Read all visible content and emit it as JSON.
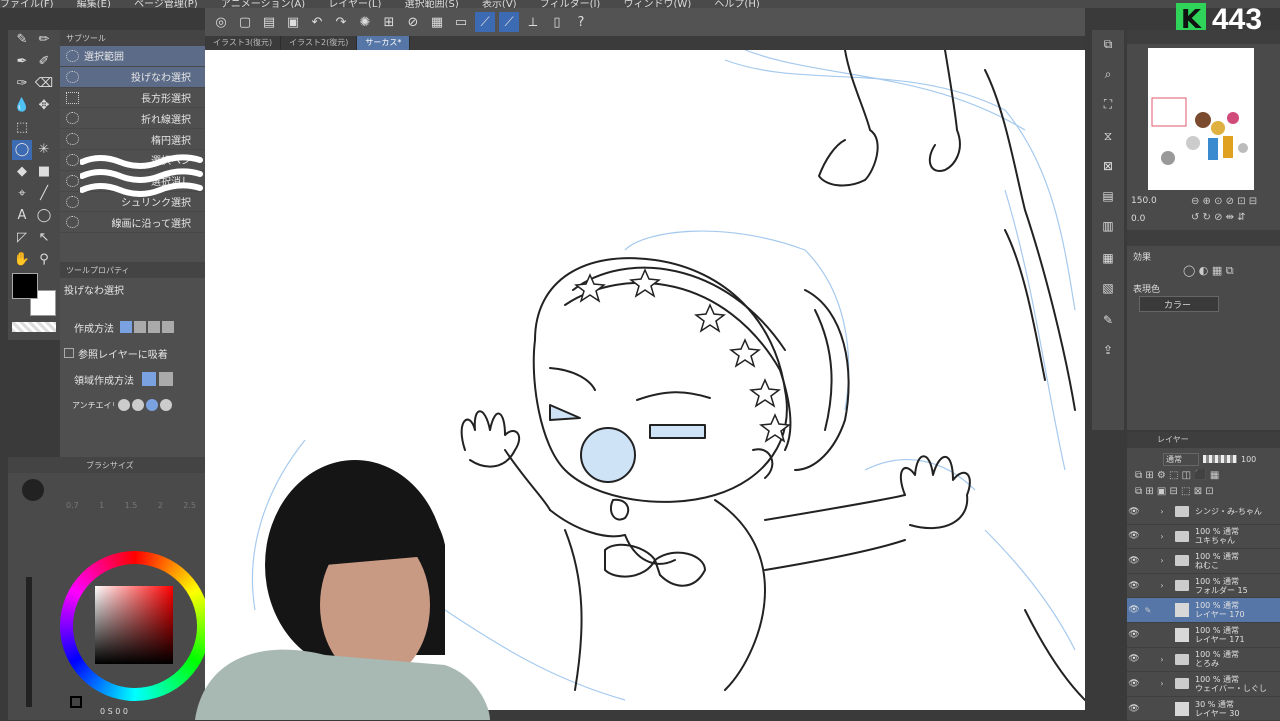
{
  "menubar": {
    "items": [
      "ファイル(F)",
      "編集(E)",
      "ページ管理(P)",
      "アニメーション(A)",
      "レイヤー(L)",
      "選択範囲(S)",
      "表示(V)",
      "フィルター(I)",
      "ウィンドウ(W)",
      "ヘルプ(H)"
    ]
  },
  "logo": {
    "letter": "K",
    "number": "443"
  },
  "canvas_tabs": [
    {
      "label": "イラスト3(復元)"
    },
    {
      "label": "イラスト2(復元)"
    },
    {
      "label": "サーカス*"
    }
  ],
  "subtool": {
    "header": "サブツール",
    "items": [
      {
        "label": "選択範囲"
      },
      {
        "label": "投げなわ選択"
      },
      {
        "label": "長方形選択"
      },
      {
        "label": "折れ線選択"
      },
      {
        "label": "楕円選択"
      },
      {
        "label": "選択ペン"
      },
      {
        "label": "選択消し"
      },
      {
        "label": "シュリンク選択"
      },
      {
        "label": "線画に沿って選択"
      }
    ]
  },
  "toolprop": {
    "header": "ツールプロパティ",
    "tool_name": "投げなわ選択",
    "create_method": "作成方法",
    "ref_layer": "参照レイヤーに吸着",
    "area_method": "領域作成方法",
    "antialias": "アンチエイリアス"
  },
  "brushsize": {
    "header": "ブラシサイズ",
    "sizes": [
      "0.7",
      "1",
      "1.5",
      "2",
      "2.5"
    ]
  },
  "colors": {
    "main": "#000000",
    "sub": "#ffffff",
    "selection": "#3d6bb3"
  },
  "bottom_status": {
    "text": "0 S 0 0"
  },
  "navigator": {
    "zoom": "150.0",
    "angle": "0.0"
  },
  "effects": {
    "title": "効果",
    "expression_label": "表現色",
    "expression_value": "カラー"
  },
  "layers": {
    "title": "レイヤー",
    "blend_mode": "通常",
    "opacity": "100",
    "items": [
      {
        "line1": "シンジ・み-ちゃん",
        "line2": "",
        "type": "folder",
        "selected": false
      },
      {
        "line1": "100 % 通常",
        "line2": "ユキちゃん",
        "type": "folder",
        "selected": false
      },
      {
        "line1": "100 % 通常",
        "line2": "ねむこ",
        "type": "folder",
        "selected": false
      },
      {
        "line1": "100 % 通常",
        "line2": "フォルダー 15",
        "type": "folder",
        "selected": false
      },
      {
        "line1": "100 % 通常",
        "line2": "レイヤー 170",
        "type": "layer",
        "selected": true
      },
      {
        "line1": "100 % 通常",
        "line2": "レイヤー 171",
        "type": "layer",
        "selected": false
      },
      {
        "line1": "100 % 通常",
        "line2": "とろみ",
        "type": "folder",
        "selected": false
      },
      {
        "line1": "100 % 通常",
        "line2": "ウェイバー・しぐし",
        "type": "folder",
        "selected": false
      },
      {
        "line1": "30 % 通常",
        "line2": "レイヤー 30",
        "type": "layer",
        "selected": false
      }
    ]
  }
}
